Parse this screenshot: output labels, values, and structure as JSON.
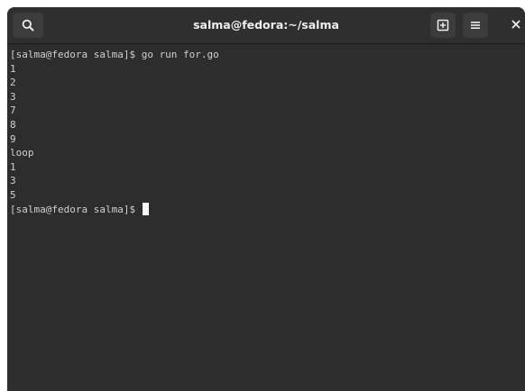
{
  "window": {
    "title": "salma@fedora:~/salma"
  },
  "headerbar": {
    "search_icon": "search-icon",
    "new_tab_icon": "new-tab-icon",
    "menu_icon": "hamburger-menu-icon",
    "close_icon": "close-icon"
  },
  "terminal": {
    "lines": [
      "[salma@fedora salma]$ go run for.go",
      "1",
      "2",
      "3",
      "7",
      "8",
      "9",
      "loop",
      "1",
      "3",
      "5"
    ],
    "prompt": "[salma@fedora salma]$ "
  },
  "colors": {
    "background": "#2d2d2d",
    "headerbar": "#2f2f2f",
    "text": "#d0d0cf",
    "cursor": "#ffffff"
  }
}
